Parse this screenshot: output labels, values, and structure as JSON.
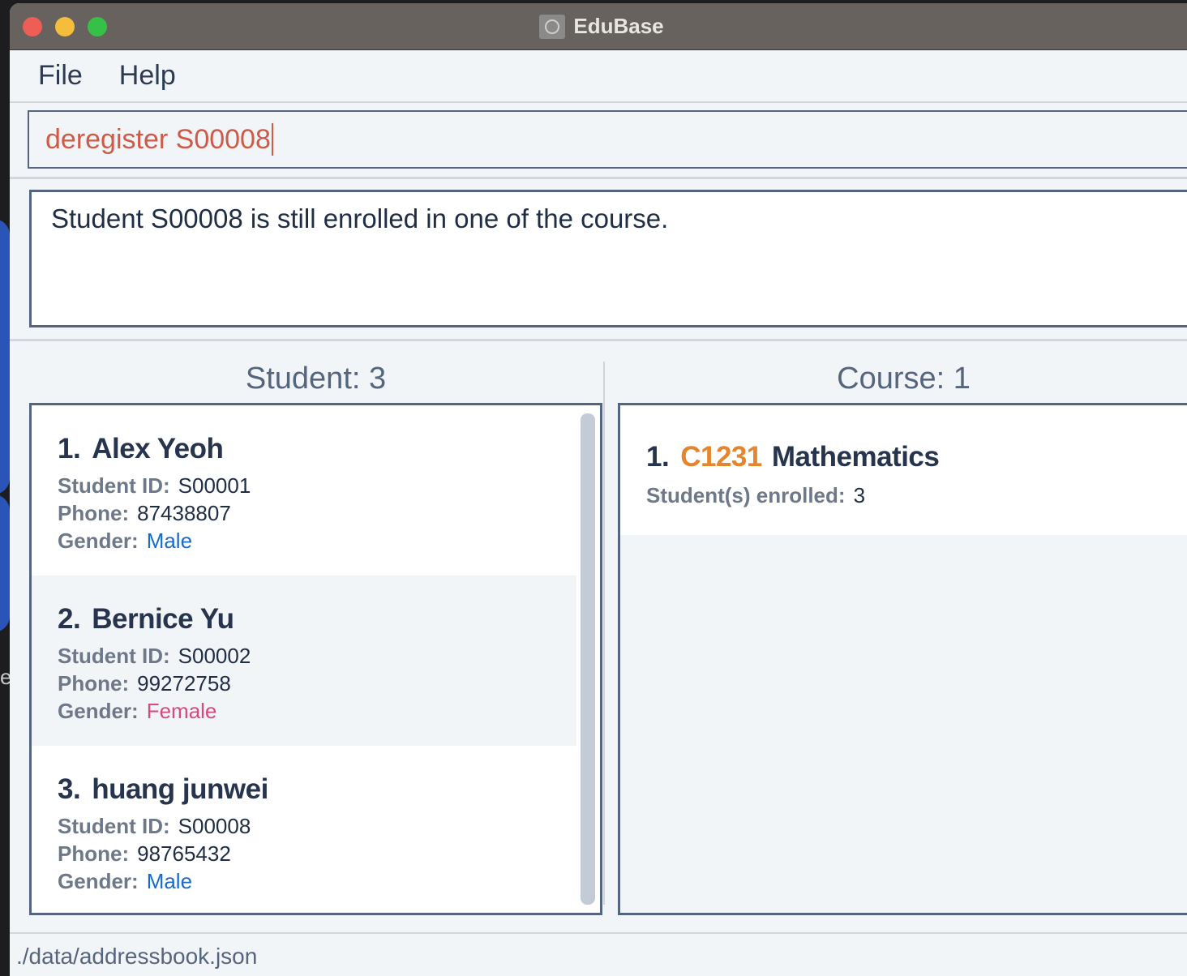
{
  "window": {
    "title": "EduBase"
  },
  "menu": {
    "file": "File",
    "help": "Help"
  },
  "command": {
    "value": "deregister S00008"
  },
  "result": {
    "message": "Student S00008 is still enrolled in one of the course."
  },
  "students": {
    "title": "Student: 3",
    "labels": {
      "id": "Student ID:",
      "phone": "Phone:",
      "gender": "Gender:"
    },
    "items": [
      {
        "index": "1.",
        "name": "Alex Yeoh",
        "id": "S00001",
        "phone": "87438807",
        "gender": "Male"
      },
      {
        "index": "2.",
        "name": "Bernice Yu",
        "id": "S00002",
        "phone": "99272758",
        "gender": "Female"
      },
      {
        "index": "3.",
        "name": "huang junwei",
        "id": "S00008",
        "phone": "98765432",
        "gender": "Male"
      }
    ]
  },
  "courses": {
    "title": "Course: 1",
    "enrolled_label": "Student(s) enrolled:",
    "items": [
      {
        "index": "1.",
        "code": "C1231",
        "name": "Mathematics",
        "enrolled": "3"
      }
    ]
  },
  "status": {
    "file_path": "./data/addressbook.json"
  },
  "colors": {
    "male": "#1a6bc9",
    "female": "#d64a7e",
    "course_code": "#e5862e",
    "command_text": "#d05a48"
  }
}
